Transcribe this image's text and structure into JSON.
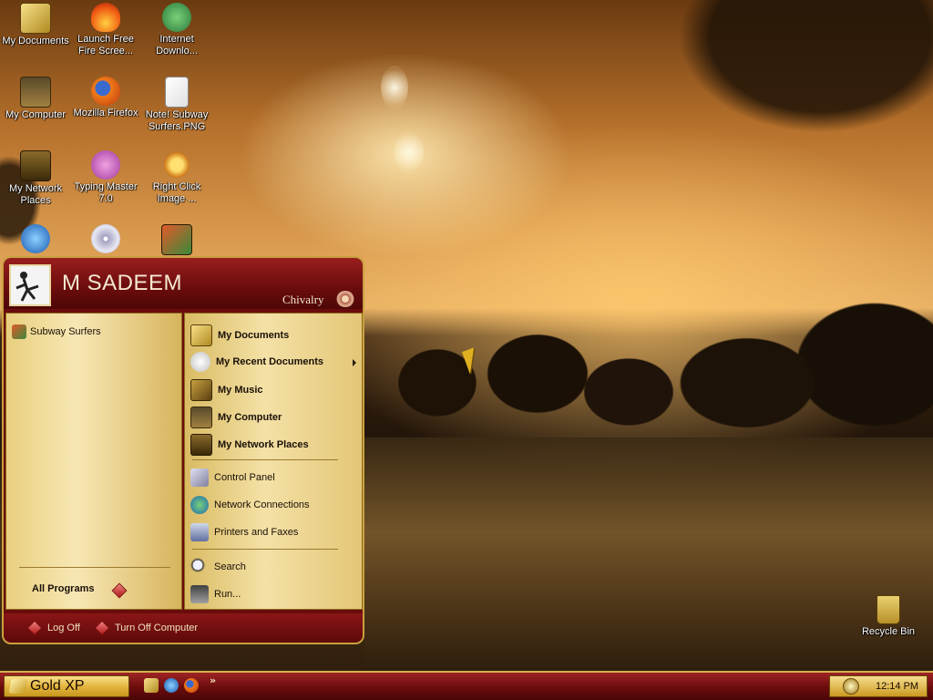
{
  "desktop": {
    "icons": [
      {
        "label": "My Documents",
        "icon": "folder-icon",
        "color": "#d8b23c"
      },
      {
        "label": "Launch Free Fire Scree...",
        "icon": "fire-icon",
        "color": "#f05a12"
      },
      {
        "label": "Internet Downlo...",
        "icon": "download-manager-icon",
        "color": "#3a9a3a"
      },
      {
        "label": "My Computer",
        "icon": "computer-icon",
        "color": "#8a6a2a"
      },
      {
        "label": "Mozilla Firefox",
        "icon": "firefox-icon",
        "color": "#e86a16"
      },
      {
        "label": "Note! Subway Surfers.PNG",
        "icon": "png-file-icon",
        "color": "#ffffff"
      },
      {
        "label": "My Network Places",
        "icon": "network-icon",
        "color": "#8a6a2a"
      },
      {
        "label": "Typing Master 7.0",
        "icon": "typing-master-icon",
        "color": "#c060c0"
      },
      {
        "label": "Right Click Image ...",
        "icon": "gear-icon",
        "color": "#d89a18"
      },
      {
        "label": "",
        "icon": "internet-explorer-icon",
        "color": "#2a78d0"
      },
      {
        "label": "",
        "icon": "dvd-icon",
        "color": "#c8c8d8"
      },
      {
        "label": "",
        "icon": "subway-surfers-icon",
        "color": "#d04a2a"
      }
    ],
    "recycle_bin": {
      "label": "Recycle Bin",
      "icon": "recycle-bin-icon"
    }
  },
  "start_menu": {
    "user_name": "M SADEEM",
    "theme_name": "Chivalry",
    "pinned": [
      {
        "label": "Subway Surfers",
        "icon": "subway-surfers-icon"
      }
    ],
    "all_programs_label": "All Programs",
    "right_items": [
      {
        "label": "My Documents",
        "icon": "folder-icon",
        "bold": true
      },
      {
        "label": "My Recent Documents",
        "icon": "recent-documents-icon",
        "bold": true,
        "has_submenu": true
      },
      {
        "label": "My Music",
        "icon": "music-folder-icon",
        "bold": true
      },
      {
        "label": "My Computer",
        "icon": "computer-icon",
        "bold": true
      },
      {
        "label": "My Network Places",
        "icon": "network-icon",
        "bold": true
      },
      {
        "label": "Control Panel",
        "icon": "control-panel-icon",
        "bold": false
      },
      {
        "label": "Network Connections",
        "icon": "network-connections-icon",
        "bold": false
      },
      {
        "label": "Printers and Faxes",
        "icon": "printer-icon",
        "bold": false
      },
      {
        "label": "Search",
        "icon": "search-icon",
        "bold": false
      },
      {
        "label": "Run...",
        "icon": "run-icon",
        "bold": false
      }
    ],
    "log_off_label": "Log Off",
    "turn_off_label": "Turn Off Computer"
  },
  "taskbar": {
    "start_label": "Gold XP",
    "quick_launch": [
      "folder-icon",
      "internet-explorer-icon",
      "firefox-icon"
    ],
    "overflow_label": "»",
    "clock": "12:14 PM"
  },
  "colors": {
    "accent_red": "#6a0c0c",
    "gold": "#e4b640"
  }
}
